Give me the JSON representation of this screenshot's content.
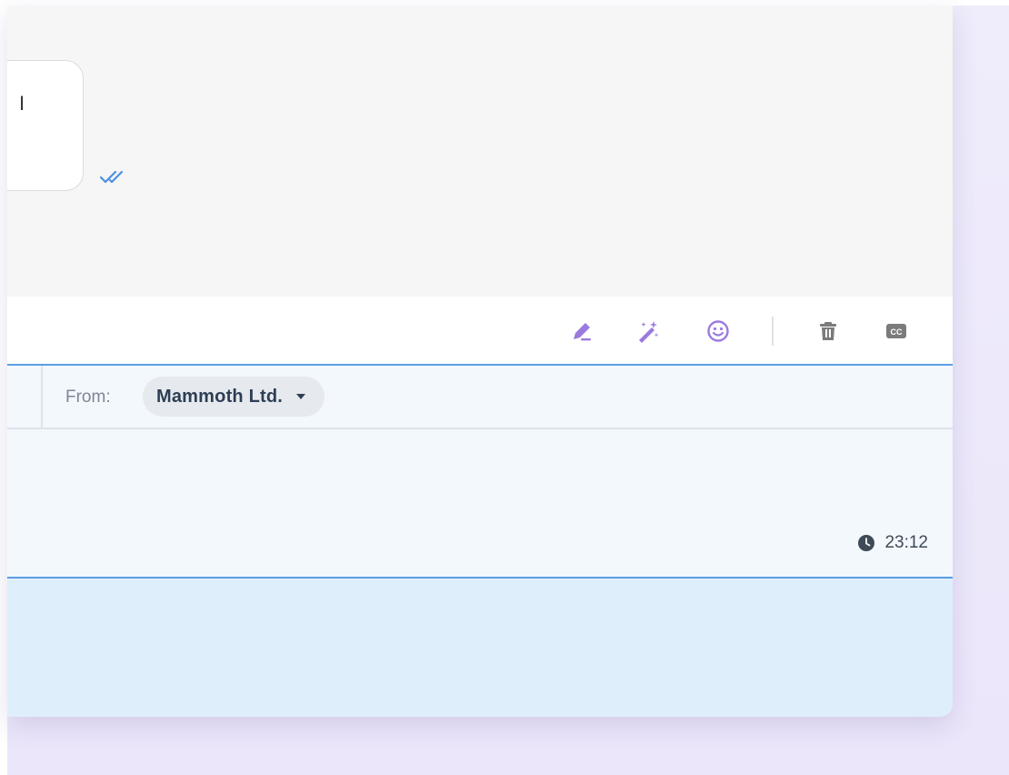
{
  "chat": {
    "bubble_text": "I",
    "read_status_icon": "double-check-icon"
  },
  "toolbar": {
    "items": [
      {
        "name": "pencil-icon",
        "color": "#9b7ae0"
      },
      {
        "name": "magic-wand-icon",
        "color": "#9b7ae0"
      },
      {
        "name": "smiley-icon",
        "color": "#9b7ae0"
      },
      {
        "name": "trash-icon",
        "color": "#7b7b7b"
      },
      {
        "name": "closed-caption-icon",
        "color": "#7b7b7b"
      }
    ]
  },
  "from": {
    "label": "From:",
    "value": "Mammoth Ltd."
  },
  "compose": {
    "time": "23:12"
  },
  "colors": {
    "accent": "#9b7ae0",
    "divider_blue": "#5b9ee0",
    "chat_bg": "#f6f6f6",
    "compose_bg": "#f3f8fd",
    "footer_bg": "#dfeefb"
  }
}
